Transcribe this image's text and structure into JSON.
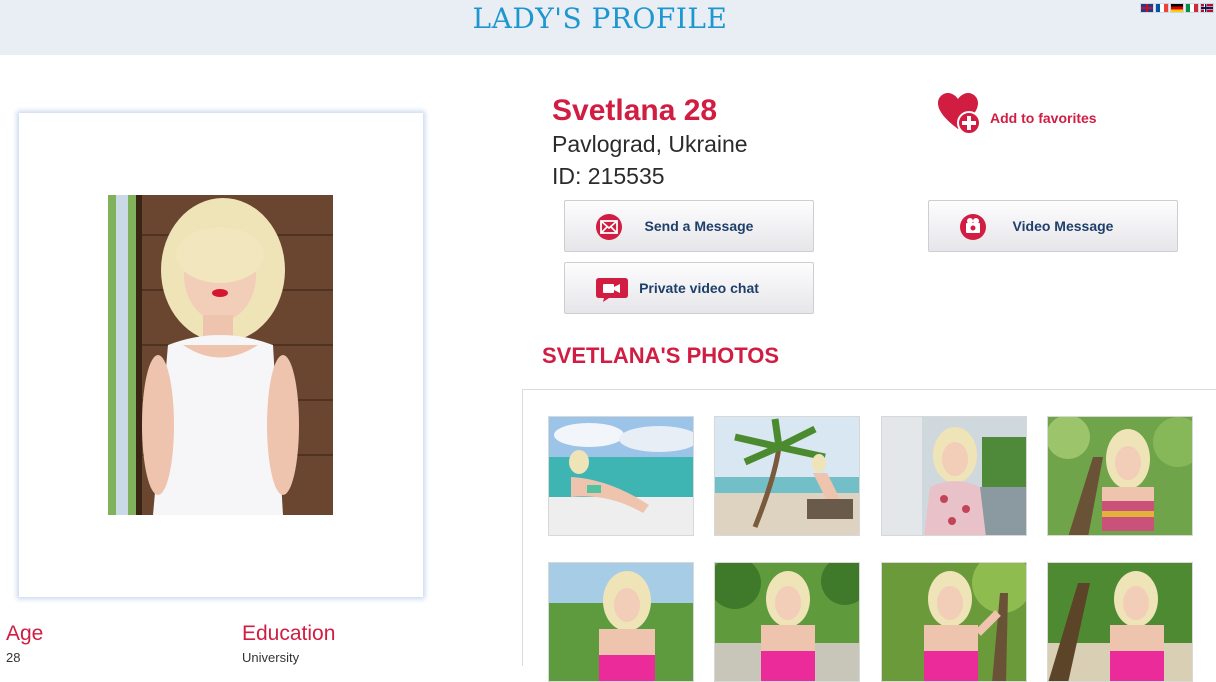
{
  "header": {
    "title": "LADY'S PROFILE",
    "languages": [
      "English",
      "French",
      "German",
      "Italian",
      "Norwegian"
    ]
  },
  "profile": {
    "name_age": "Svetlana 28",
    "location": "Pavlograd, Ukraine",
    "id_text": "ID: 215535",
    "favorites_label": "Add to favorites",
    "actions": {
      "send_message": "Send a Message",
      "video_message": "Video Message",
      "private_chat": "Private video chat"
    },
    "details": [
      {
        "label": "Age",
        "value": "28"
      },
      {
        "label": "Education",
        "value": "University"
      }
    ]
  },
  "photos": {
    "heading": "SVETLANA'S PHOTOS",
    "items": [
      "beach-yacht",
      "palm-beach",
      "city-blouse",
      "tree-top",
      "lake-pink",
      "park-pink",
      "tree-pink",
      "forest-pink"
    ]
  },
  "colors": {
    "accent_red": "#d11d42",
    "heading_blue": "#1e97d0",
    "button_text": "#1f3f6a",
    "topbar_bg": "#e9eef5"
  }
}
